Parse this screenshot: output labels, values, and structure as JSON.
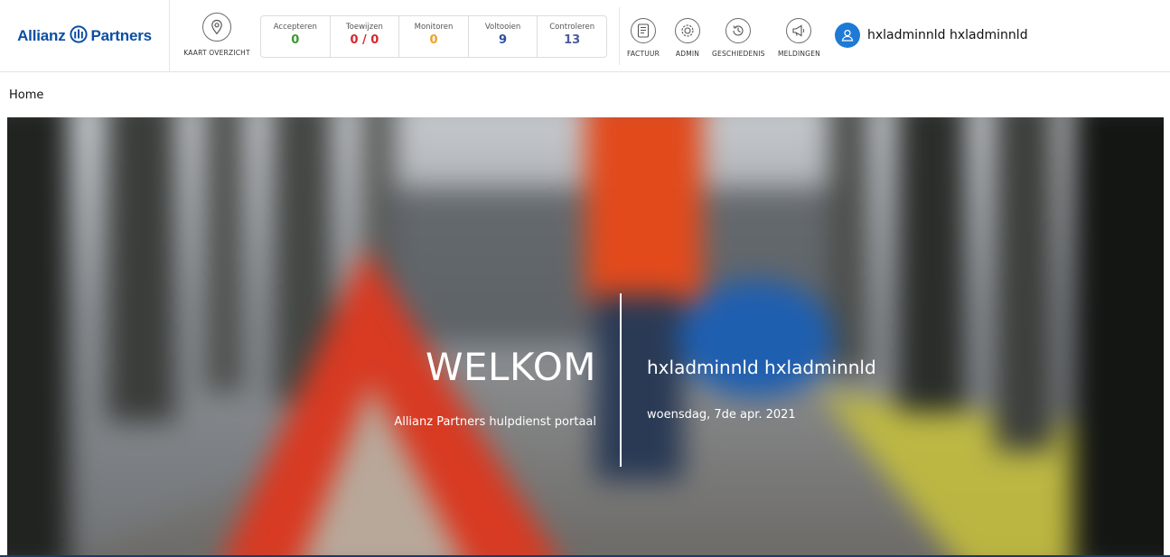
{
  "brand": {
    "name_left": "Allianz",
    "name_right": "Partners"
  },
  "map_overview": {
    "label": "KAART OVERZICHT"
  },
  "stats": [
    {
      "label": "Accepteren",
      "value": "0",
      "color": "#3a9a2f"
    },
    {
      "label": "Toewijzen",
      "value": "0 / 0",
      "color": "#d6282f"
    },
    {
      "label": "Monitoren",
      "value": "0",
      "color": "#f0a125"
    },
    {
      "label": "Voltooien",
      "value": "9",
      "color": "#2b4fa5"
    },
    {
      "label": "Controleren",
      "value": "13",
      "color": "#4a5b9c"
    }
  ],
  "nav": {
    "invoice": {
      "label": "FACTUUR"
    },
    "admin": {
      "label": "ADMIN"
    },
    "history": {
      "label": "GESCHIEDENIS"
    },
    "notifications": {
      "label": "MELDINGEN"
    }
  },
  "user": {
    "name": "hxladminnld hxladminnld"
  },
  "breadcrumb": {
    "home": "Home"
  },
  "hero": {
    "welcome": "WELKOM",
    "subtitle": "Allianz Partners hulpdienst portaal",
    "user": "hxladminnld hxladminnld",
    "date": "woensdag, 7de apr. 2021"
  },
  "colors": {
    "brand": "#0b4ea2",
    "avatar": "#1e7ad6",
    "footer_bar": "#1a3b6a"
  }
}
